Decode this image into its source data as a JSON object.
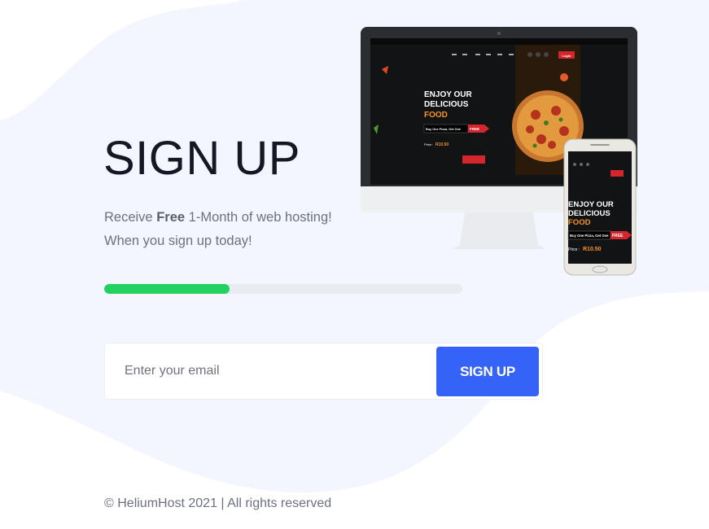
{
  "page": {
    "title": "SIGN UP",
    "subtitle_prefix": "Receive ",
    "subtitle_bold": "Free",
    "subtitle_suffix": " 1-Month of web hosting!",
    "subtitle_line2": "When you sign up today!"
  },
  "progress": {
    "value_percent": 35,
    "color": "#22d161",
    "track_color": "#e8ebf0"
  },
  "form": {
    "email_placeholder": "Enter your email",
    "submit_label": "SIGN UP"
  },
  "mockup": {
    "headline_line1": "ENJOY OUR",
    "headline_line2": "DELICIOUS",
    "headline_line3": "FOOD",
    "offer_label": "Buy One Pizza, Get One",
    "offer_badge": "FREE",
    "price_label": "Price :",
    "price_value": "R10.50",
    "login_label": "Login"
  },
  "footer": {
    "text": "© HeliumHost 2021 | All rights reserved"
  },
  "colors": {
    "accent": "#3563f7",
    "background_blob": "#f3f6fe",
    "heading": "#141824",
    "muted_text": "#6b7180"
  }
}
